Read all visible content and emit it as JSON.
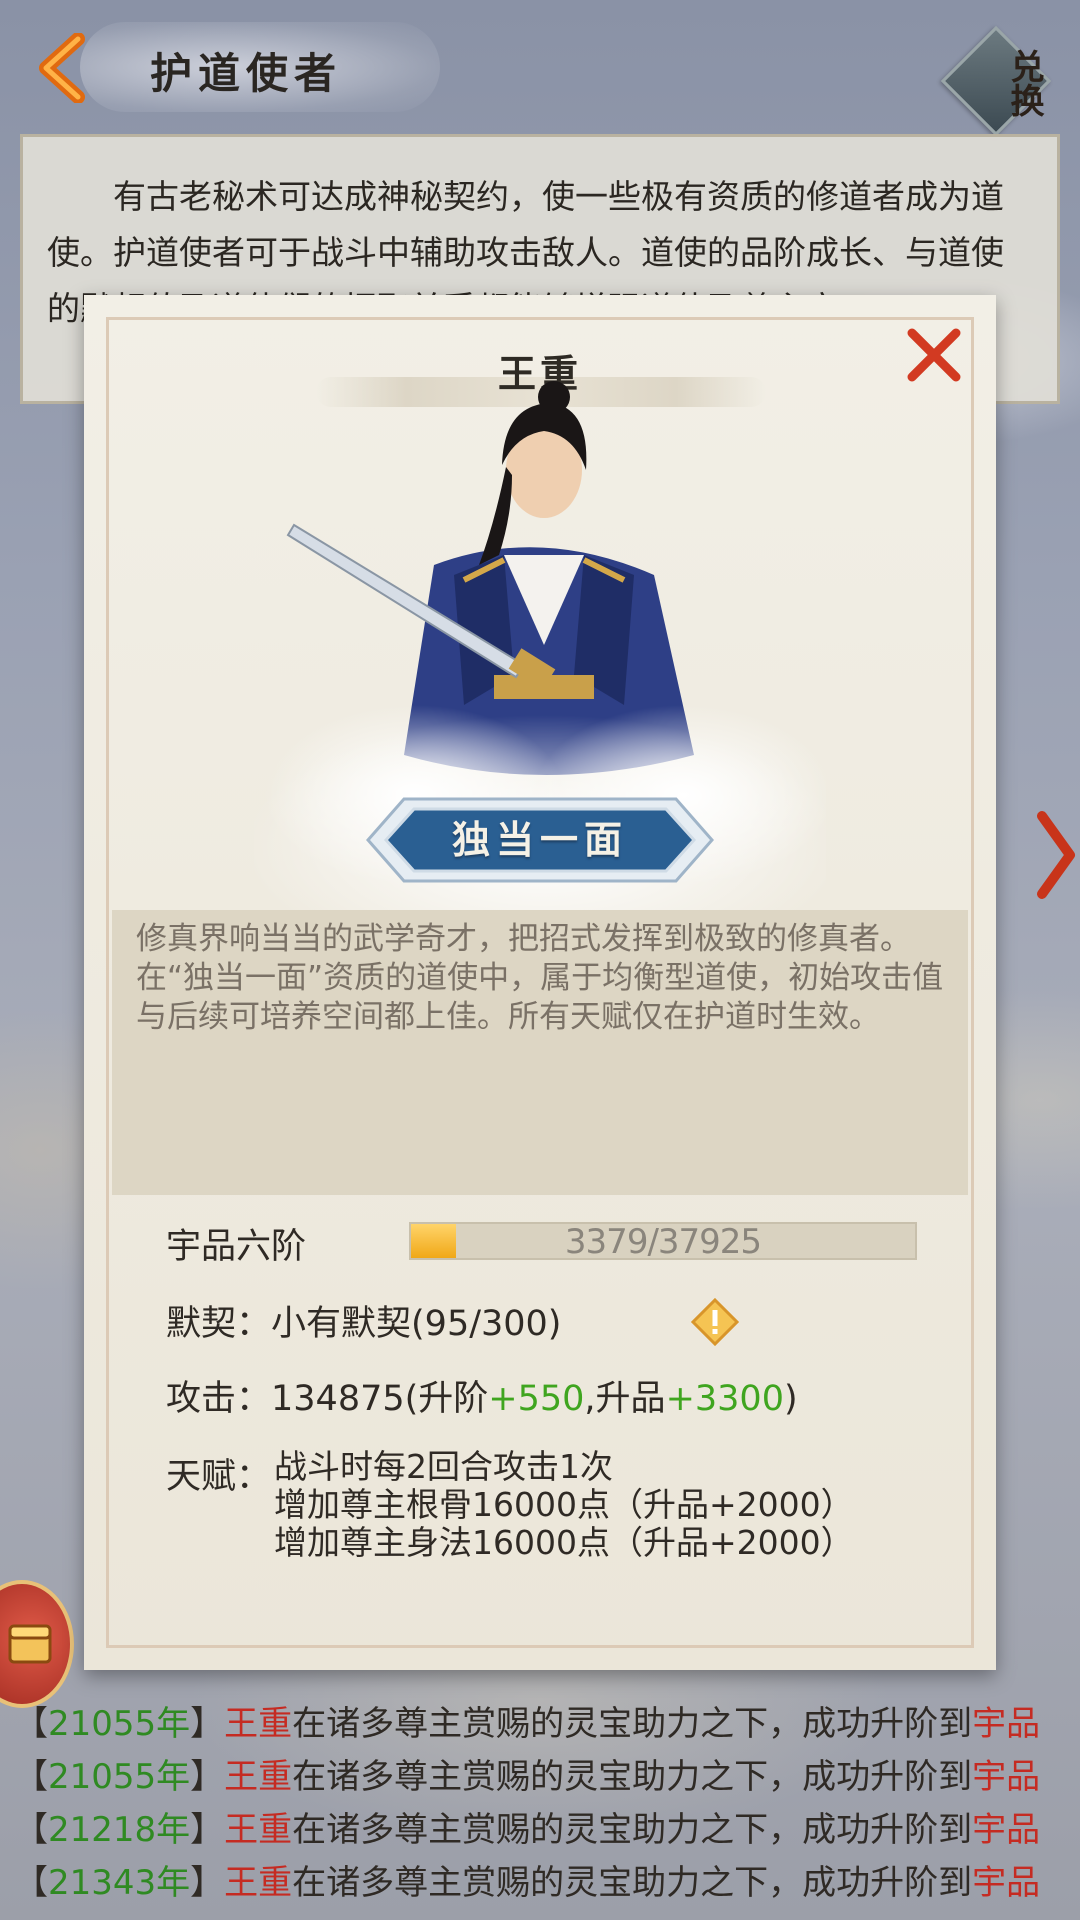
{
  "header": {
    "back_icon": "back-arrow-icon",
    "title": "护道使者",
    "exchange_label": "兑换"
  },
  "intro": {
    "text": "有古老秘术可达成神秘契约，使一些极有资质的修道者成为道使。护道使者可于战斗中辅助攻击敌人。道使的品阶成长、与道使的默契值及道使们的招聚并受都能够增强道使及尊主实"
  },
  "modal": {
    "character_name": "王重",
    "aptitude_badge": "独当一面",
    "description": "修真界响当当的武学奇才，把招式发挥到极致的修真者。在“独当一面”资质的道使中，属于均衡型道使，初始攻击值与后续可培养空间都上佳。所有天赋仅在护道时生效。",
    "rank_label": "宇品六阶",
    "exp_text": "3379/37925",
    "exp_progress": 0.089,
    "bond_label": "默契：",
    "bond_value": "小有默契(95/300)",
    "attack_label": "攻击：",
    "attack_base": "134875(升阶",
    "attack_upgrade": "+550",
    "attack_mid": ",升品",
    "attack_promote": "+3300",
    "attack_end": ")",
    "talent_label": "天赋：",
    "talents": [
      "战斗时每2回合攻击1次",
      "增加尊主根骨16000点（升品+2000）",
      "增加尊主身法16000点（升品+2000）"
    ]
  },
  "log": [
    {
      "open": "【",
      "year": "21055年",
      "close": "】",
      "name": "王重",
      "text": "在诸多尊主赏赐的灵宝助力之下，成功升阶到",
      "rank": "宇品"
    },
    {
      "open": "【",
      "year": "21055年",
      "close": "】",
      "name": "王重",
      "text": "在诸多尊主赏赐的灵宝助力之下，成功升阶到",
      "rank": "宇品"
    },
    {
      "open": "【",
      "year": "21218年",
      "close": "】",
      "name": "王重",
      "text": "在诸多尊主赏赐的灵宝助力之下，成功升阶到",
      "rank": "宇品"
    },
    {
      "open": "【",
      "year": "21343年",
      "close": "】",
      "name": "王重",
      "text": "在诸多尊主赏赐的灵宝助力之下，成功升阶到",
      "rank": "宇品"
    }
  ],
  "colors": {
    "accent_green": "#3fa51f",
    "name_red": "#c52b22",
    "progress_gold": "#f0a817",
    "badge_blue": "#2a5f92"
  }
}
